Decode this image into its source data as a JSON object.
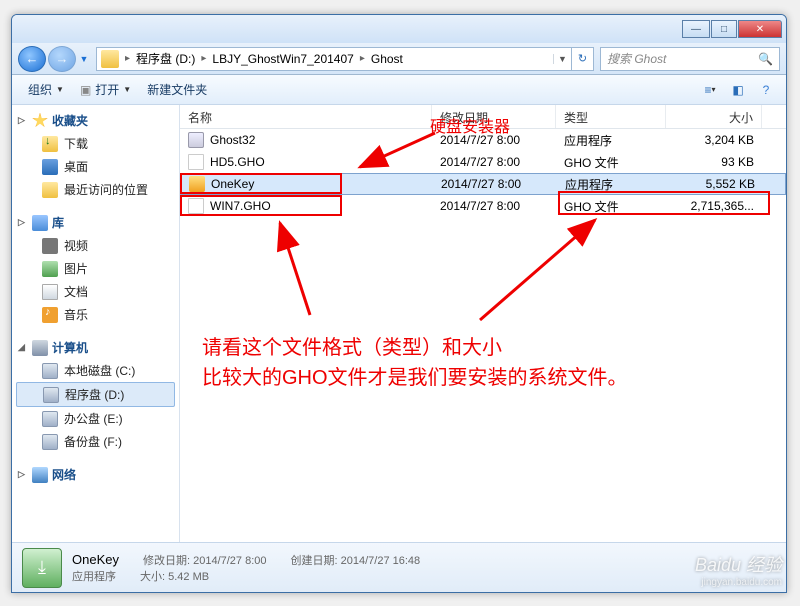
{
  "breadcrumb": {
    "root": "程序盘 (D:)",
    "p1": "LBJY_GhostWin7_201407",
    "p2": "Ghost"
  },
  "search": {
    "placeholder": "搜索 Ghost"
  },
  "toolbar": {
    "organize": "组织",
    "open": "打开",
    "newfolder": "新建文件夹"
  },
  "sidebar": {
    "fav": "收藏夹",
    "dl": "下载",
    "desktop": "桌面",
    "recent": "最近访问的位置",
    "lib": "库",
    "video": "视频",
    "pic": "图片",
    "doc": "文档",
    "music": "音乐",
    "comp": "计算机",
    "drive_c": "本地磁盘 (C:)",
    "drive_d": "程序盘 (D:)",
    "drive_e": "办公盘 (E:)",
    "drive_f": "备份盘 (F:)",
    "net": "网络"
  },
  "columns": {
    "name": "名称",
    "date": "修改日期",
    "type": "类型",
    "size": "大小"
  },
  "files": [
    {
      "name": "Ghost32",
      "date": "2014/7/27 8:00",
      "type": "应用程序",
      "size": "3,204 KB"
    },
    {
      "name": "HD5.GHO",
      "date": "2014/7/27 8:00",
      "type": "GHO 文件",
      "size": "93 KB"
    },
    {
      "name": "OneKey",
      "date": "2014/7/27 8:00",
      "type": "应用程序",
      "size": "5,552 KB"
    },
    {
      "name": "WIN7.GHO",
      "date": "2014/7/27 8:00",
      "type": "GHO 文件",
      "size": "2,715,365..."
    }
  ],
  "annot": {
    "label1": "硬盘安装器",
    "line1": "请看这个文件格式（类型）和大小",
    "line2": "比较大的GHO文件才是我们要安装的系统文件。"
  },
  "status": {
    "name": "OneKey",
    "mdate_label": "修改日期:",
    "mdate": "2014/7/27 8:00",
    "cdate_label": "创建日期:",
    "cdate": "2014/7/27 16:48",
    "type": "应用程序",
    "size_label": "大小:",
    "size": "5.42 MB"
  },
  "watermark": {
    "brand": "Baidu 经验",
    "sub": "jingyan.baidu.com"
  }
}
